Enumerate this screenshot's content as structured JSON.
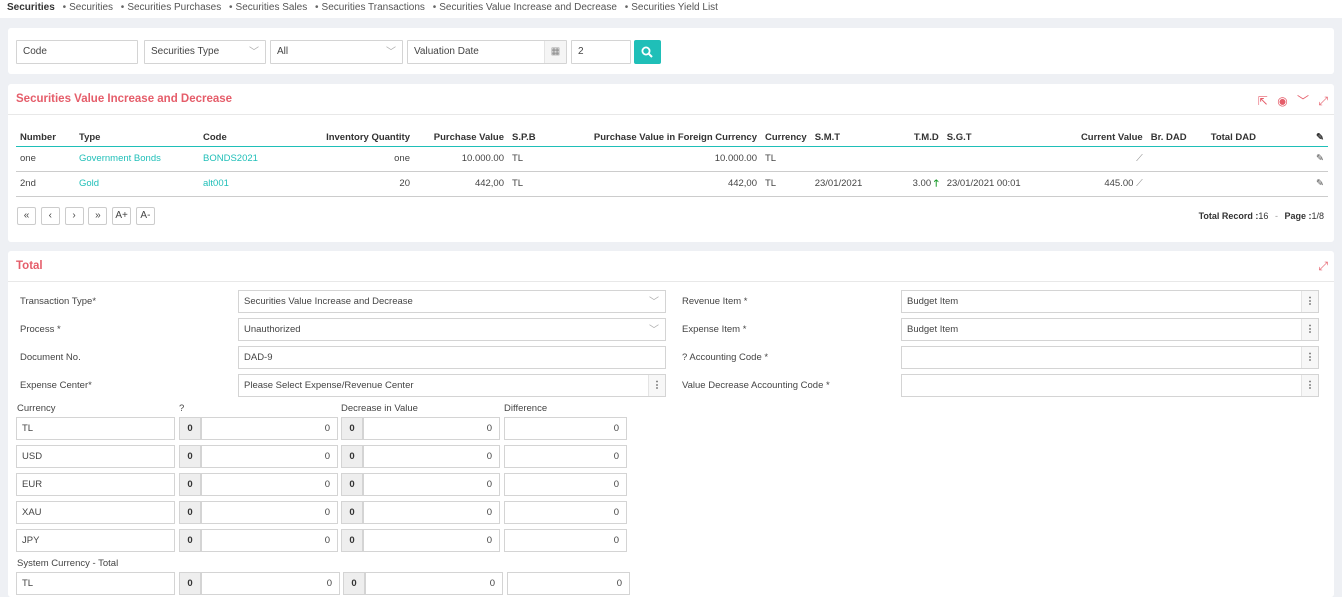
{
  "nav": {
    "items": [
      "Securities",
      "Securities",
      "Securities Purchases",
      "Securities Sales",
      "Securities Transactions",
      "Securities Value Increase and Decrease",
      "Securities Yield List"
    ]
  },
  "filter": {
    "code_placeholder": "Code",
    "type_value": "Securities Type",
    "all_value": "All",
    "date_placeholder": "Valuation Date",
    "number_value": "2"
  },
  "list": {
    "title": "Securities Value Increase and Decrease",
    "columns": {
      "number": "Number",
      "type": "Type",
      "code": "Code",
      "qty": "Inventory Quantity",
      "pv": "Purchase Value",
      "spb": "S.P.B",
      "pvfc": "Purchase Value in Foreign Currency",
      "currency": "Currency",
      "smt": "S.M.T",
      "tmd": "T.M.D",
      "sgt": "S.G.T",
      "cv": "Current Value",
      "brdad": "Br. DAD",
      "totdad": "Total DAD"
    },
    "rows": [
      {
        "number": "one",
        "type": "Government Bonds",
        "code": "BONDS2021",
        "qty": "one",
        "pv": "10.000.00",
        "spb": "TL",
        "pvfc": "10.000.00",
        "currency": "TL",
        "smt": "",
        "tmd": "",
        "sgt": "",
        "cv": "",
        "brdad": "",
        "totdad": ""
      },
      {
        "number": "2nd",
        "type": "Gold",
        "code": "alt001",
        "qty": "20",
        "pv": "442,00",
        "spb": "TL",
        "pvfc": "442,00",
        "currency": "TL",
        "smt": "23/01/2021",
        "tmd": "3.00",
        "sgt": "23/01/2021 00:01",
        "cv": "445.00",
        "brdad": "",
        "totdad": ""
      }
    ],
    "pager": {
      "first": "«",
      "prev": "‹",
      "next": "›",
      "last": "»",
      "font_up": "A+",
      "font_down": "A-",
      "total_label": "Total Record :",
      "total_value": "16",
      "separator": "-",
      "page_label": "Page :",
      "page_value": "1/8"
    }
  },
  "total": {
    "title": "Total",
    "fields": {
      "transaction_type_label": "Transaction Type*",
      "transaction_type_value": "Securities Value Increase and Decrease",
      "process_label": "Process *",
      "process_value": "Unauthorized",
      "document_no_label": "Document No.",
      "document_no_value": "DAD-9",
      "expense_center_label": "Expense Center*",
      "expense_center_value": "Please Select Expense/Revenue Center",
      "revenue_item_label": "Revenue Item *",
      "revenue_item_value": "Budget Item",
      "expense_item_label": "Expense Item *",
      "expense_item_value": "Budget Item",
      "accounting_code_label": "? Accounting Code *",
      "accounting_code_value": "",
      "value_decrease_label": "Value Decrease Accounting Code *",
      "value_decrease_value": ""
    },
    "table": {
      "headers": {
        "currency": "Currency",
        "q": "?",
        "decrease": "Decrease in Value",
        "difference": "Difference"
      },
      "rows": [
        {
          "currency": "TL",
          "prefix1": "0",
          "v1": "0",
          "prefix2": "0",
          "v2": "0",
          "v3": "0"
        },
        {
          "currency": "USD",
          "prefix1": "0",
          "v1": "0",
          "prefix2": "0",
          "v2": "0",
          "v3": "0"
        },
        {
          "currency": "EUR",
          "prefix1": "0",
          "v1": "0",
          "prefix2": "0",
          "v2": "0",
          "v3": "0"
        },
        {
          "currency": "XAU",
          "prefix1": "0",
          "v1": "0",
          "prefix2": "0",
          "v2": "0",
          "v3": "0"
        },
        {
          "currency": "JPY",
          "prefix1": "0",
          "v1": "0",
          "prefix2": "0",
          "v2": "0",
          "v3": "0"
        }
      ],
      "system_total_label": "System Currency - Total",
      "system_total": {
        "currency": "TL",
        "prefix1": "0",
        "v1": "0",
        "prefix2": "0",
        "v2": "0",
        "v3": "0"
      }
    }
  },
  "colors": {
    "accent": "#1fbfb8",
    "title": "#e55d6a",
    "arrow_up": "#1a9a2a"
  }
}
